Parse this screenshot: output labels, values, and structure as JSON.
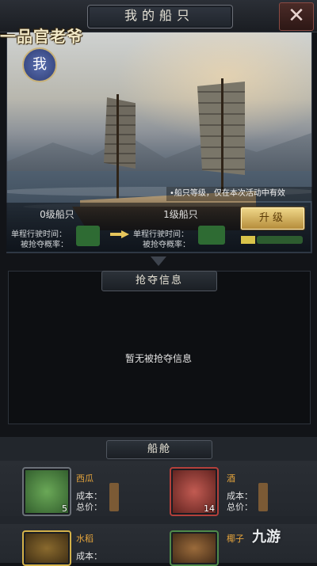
{
  "header": {
    "title": "我的船只",
    "close_label": "✕"
  },
  "logo": {
    "title": "一品官老爷",
    "badge": "我"
  },
  "ship": {
    "note": "•船只等级，仅在本次活动中有效",
    "current_level": "0级船只",
    "next_level": "1级船只",
    "row1_label": "单程行驶时间：",
    "row2_label": "被抢夺概率：",
    "next_row1_label": "单程行驶时间：",
    "next_row2_label": "被抢夺概率：",
    "upgrade_label": "升级"
  },
  "rob": {
    "title": "抢夺信息",
    "empty_text": "暂无被抢夺信息"
  },
  "cabin": {
    "title": "船舱",
    "items": [
      {
        "name": "西瓜",
        "count": "5",
        "cost_label": "成本：",
        "total_label": "总价：",
        "icon": "watermelon-icon"
      },
      {
        "name": "酒",
        "count": "14",
        "cost_label": "成本：",
        "total_label": "总价：",
        "icon": "wine-jar-icon"
      },
      {
        "name": "水稻",
        "count": "",
        "cost_label": "成本：",
        "total_label": "",
        "icon": "rice-icon"
      },
      {
        "name": "椰子",
        "count": "",
        "cost_label": "",
        "total_label": "",
        "icon": "coconut-icon"
      }
    ]
  },
  "watermark": {
    "text": "九游"
  },
  "colors": {
    "gold": "#e3a33c",
    "upgrade_bg": "#e4c36f",
    "panel_bg": "#0d0f12"
  }
}
